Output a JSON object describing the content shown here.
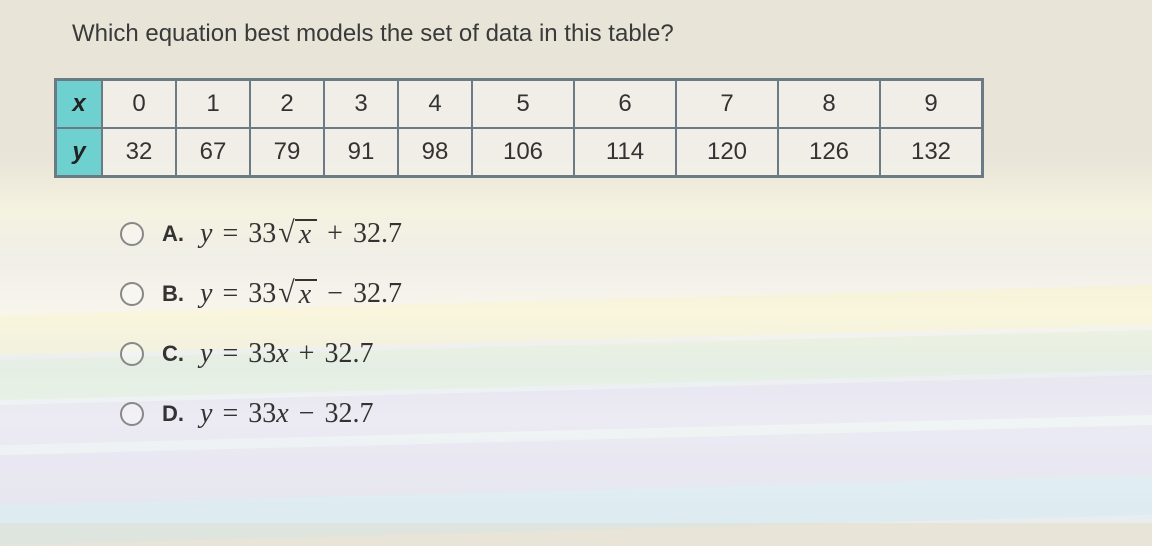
{
  "question": "Which equation best models the set of data in this table?",
  "table": {
    "header_x": "x",
    "header_y": "y",
    "x": [
      "0",
      "1",
      "2",
      "3",
      "4",
      "5",
      "6",
      "7",
      "8",
      "9"
    ],
    "y": [
      "32",
      "67",
      "79",
      "91",
      "98",
      "106",
      "114",
      "120",
      "126",
      "132"
    ]
  },
  "options": {
    "A": {
      "letter": "A.",
      "pre": "y",
      "eq": "=",
      "coef": "33",
      "sqrt": true,
      "radicand": "x",
      "op": "+",
      "const": "32.7"
    },
    "B": {
      "letter": "B.",
      "pre": "y",
      "eq": "=",
      "coef": "33",
      "sqrt": true,
      "radicand": "x",
      "op": "−",
      "const": "32.7"
    },
    "C": {
      "letter": "C.",
      "pre": "y",
      "eq": "=",
      "coef": "33",
      "var": "x",
      "op": "+",
      "const": "32.7"
    },
    "D": {
      "letter": "D.",
      "pre": "y",
      "eq": "=",
      "coef": "33",
      "var": "x",
      "op": "−",
      "const": "32.7"
    }
  }
}
